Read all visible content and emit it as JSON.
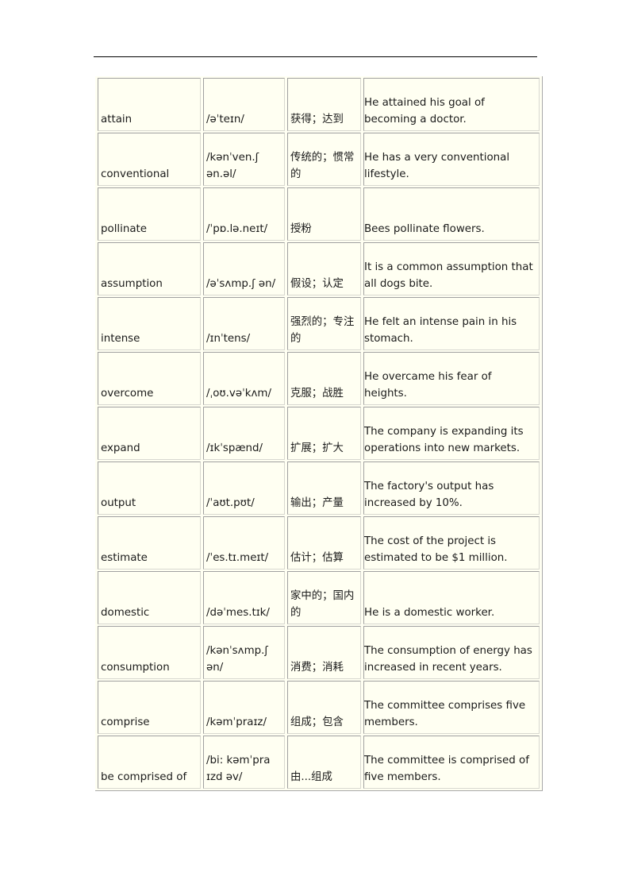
{
  "rows": [
    {
      "word": "attain",
      "ipa": "/əˈteɪn/",
      "meaning": "获得；达到",
      "example": "He attained his goal of becoming a doctor."
    },
    {
      "word": "conventional",
      "ipa": "/kənˈven.ʃ ən.əl/",
      "meaning": "传统的；惯常的",
      "example": "He has a very conventional lifestyle."
    },
    {
      "word": "pollinate",
      "ipa": "/ˈpɒ.lə.neɪt/",
      "meaning": "授粉",
      "example": "Bees pollinate flowers."
    },
    {
      "word": "assumption",
      "ipa": "/əˈsʌmp.ʃ ən/",
      "meaning": "假设；认定",
      "example": "It is a common assumption that all dogs bite."
    },
    {
      "word": "intense",
      "ipa": "/ɪnˈtens/",
      "meaning": "强烈的；专注的",
      "example": "He felt an intense pain in his stomach."
    },
    {
      "word": "overcome",
      "ipa": "/ˌoʊ.vəˈkʌm/",
      "meaning": "克服；战胜",
      "example": "He overcame his fear of heights."
    },
    {
      "word": "expand",
      "ipa": "/ɪkˈspænd/",
      "meaning": "扩展；扩大",
      "example": "The company is expanding its operations into new markets."
    },
    {
      "word": "output",
      "ipa": "/ˈaʊt.pʊt/",
      "meaning": "输出；产量",
      "example": "The factory's output has increased by 10%."
    },
    {
      "word": "estimate",
      "ipa": "/ˈes.tɪ.meɪt/",
      "meaning": "估计；估算",
      "example": "The cost of the project is estimated to be $1 million."
    },
    {
      "word": "domestic",
      "ipa": "/dəˈmes.tɪk/",
      "meaning": "家中的；国内的",
      "example": "He is a domestic worker."
    },
    {
      "word": "consumption",
      "ipa": "/kənˈsʌmp.ʃ ən/",
      "meaning": "消费；消耗",
      "example": "The consumption of energy has increased in recent years."
    },
    {
      "word": "comprise",
      "ipa": "/kəmˈpraɪz/",
      "meaning": "组成；包含",
      "example": "The committee comprises five members."
    },
    {
      "word": "be comprised of",
      "ipa": "/bi: kəmˈpra ɪzd əv/",
      "meaning": "由...组成",
      "example": "The committee is comprised of five members."
    }
  ]
}
